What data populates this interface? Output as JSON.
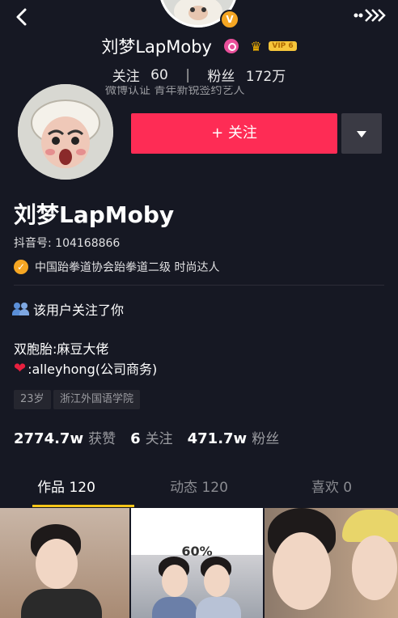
{
  "header": {
    "back_icon": "chevron-left-icon",
    "more_icon": "more-arrows-icon",
    "badge_icon": "verified-v-icon",
    "name": "刘梦LapMoby",
    "vip_label": "VIP 6",
    "stats": {
      "following_label": "关注",
      "following_value": "60",
      "separator": "|",
      "fans_label": "粉丝",
      "fans_value": "172万"
    },
    "clipped_text": "微博认证 青年新锐签约艺人"
  },
  "profile": {
    "follow_button": "+ 关注",
    "name": "刘梦LapMoby",
    "douyin_id": "抖音号: 104168866",
    "verification": "中国跆拳道协会跆拳道二级 时尚达人",
    "mutual_follow": "该用户关注了你",
    "bio_line1": "双胞胎:麻豆大佬",
    "bio_line2": ":alleyhong(公司商务)",
    "tags": [
      "23岁",
      "浙江外国语学院"
    ],
    "stats": {
      "likes_value": "2774.7w",
      "likes_label": "获赞",
      "following_value": "6",
      "following_label": "关注",
      "fans_value": "471.7w",
      "fans_label": "粉丝"
    }
  },
  "tabs": {
    "works": "作品 120",
    "dynamic": "动态 120",
    "likes": "喜欢 0",
    "active": "works"
  },
  "thumbnails": {
    "thumb2_overlay": "60%"
  },
  "colors": {
    "background": "#161823",
    "follow_button": "#fe2c55",
    "tab_indicator": "#f5c518",
    "verify_badge": "#f5a623"
  }
}
